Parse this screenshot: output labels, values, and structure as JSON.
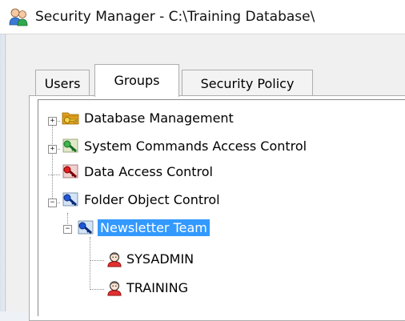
{
  "window": {
    "title": "Security Manager - C:\\Training Database\\",
    "app_icon": "users-group-icon"
  },
  "tabs": [
    {
      "label": "Users",
      "active": false
    },
    {
      "label": "Groups",
      "active": true
    },
    {
      "label": "Security Policy",
      "active": false
    }
  ],
  "tree": {
    "items": [
      {
        "label": "Database Management",
        "icon": "folder-key-icon",
        "expander": "+"
      },
      {
        "label": "System Commands Access Control",
        "icon": "green-key-icon",
        "expander": "+"
      },
      {
        "label": "Data Access Control",
        "icon": "red-key-icon",
        "expander": ""
      },
      {
        "label": "Folder Object Control",
        "icon": "blue-key-icon",
        "expander": "−"
      },
      {
        "label": "Newsletter Team",
        "icon": "blue-key-icon",
        "expander": "−",
        "selected": true
      },
      {
        "label": "SYSADMIN",
        "icon": "user-icon",
        "expander": ""
      },
      {
        "label": "TRAINING",
        "icon": "user-icon",
        "expander": ""
      }
    ]
  },
  "colors": {
    "selection": "#3399ff",
    "tree_background": "#ffffff",
    "window_background": "#f0f0f0"
  }
}
